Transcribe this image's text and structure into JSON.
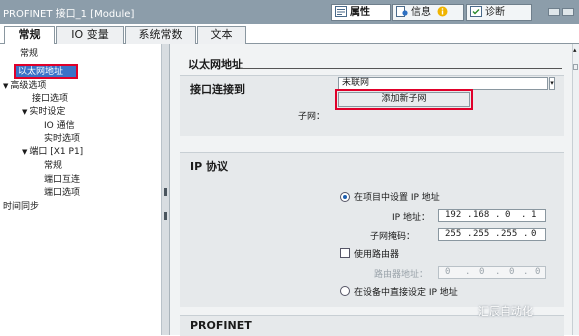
{
  "window": {
    "title": "PROFINET 接口_1 [Module]"
  },
  "inspector_tabs": [
    {
      "label": "属性"
    },
    {
      "label": "信息"
    },
    {
      "label": "诊断"
    }
  ],
  "tabs": [
    {
      "label": "常规"
    },
    {
      "label": "IO 变量"
    },
    {
      "label": "系统常数"
    },
    {
      "label": "文本"
    }
  ],
  "tree": {
    "items": [
      {
        "label": "常规"
      },
      {
        "label": "以太网地址"
      },
      {
        "label": "高级选项"
      },
      {
        "label": "接口选项"
      },
      {
        "label": "实时设定"
      },
      {
        "label": "IO 通信"
      },
      {
        "label": "实时选项"
      },
      {
        "label": "端口 [X1 P1]"
      },
      {
        "label": "常规"
      },
      {
        "label": "端口互连"
      },
      {
        "label": "端口选项"
      },
      {
        "label": "时间同步"
      }
    ]
  },
  "content": {
    "section_title": "以太网地址",
    "interface_connected": {
      "title": "接口连接到",
      "subnet_label": "子网：",
      "subnet_value": "未联网",
      "add_subnet_button": "添加新子网"
    },
    "ip_protocol": {
      "title": "IP 协议",
      "option_set_in_project": "在项目中设置 IP 地址",
      "ip_label": "IP 地址：",
      "ip_octets": [
        "192",
        "168",
        "0",
        "1"
      ],
      "mask_label": "子网掩码：",
      "mask_octets": [
        "255",
        "255",
        "255",
        "0"
      ],
      "use_router_label": "使用路由器",
      "router_label": "路由器地址：",
      "router_octets": [
        "0",
        "0",
        "0",
        "0"
      ],
      "option_set_on_device": "在设备中直接设定 IP 地址"
    },
    "profinet": {
      "title": "PROFINET"
    }
  },
  "watermark": "汇辰自动化",
  "colors": {
    "highlight_red": "#e0002a",
    "selection_blue": "#3a72c8",
    "titlebar": "#8c9daa"
  }
}
